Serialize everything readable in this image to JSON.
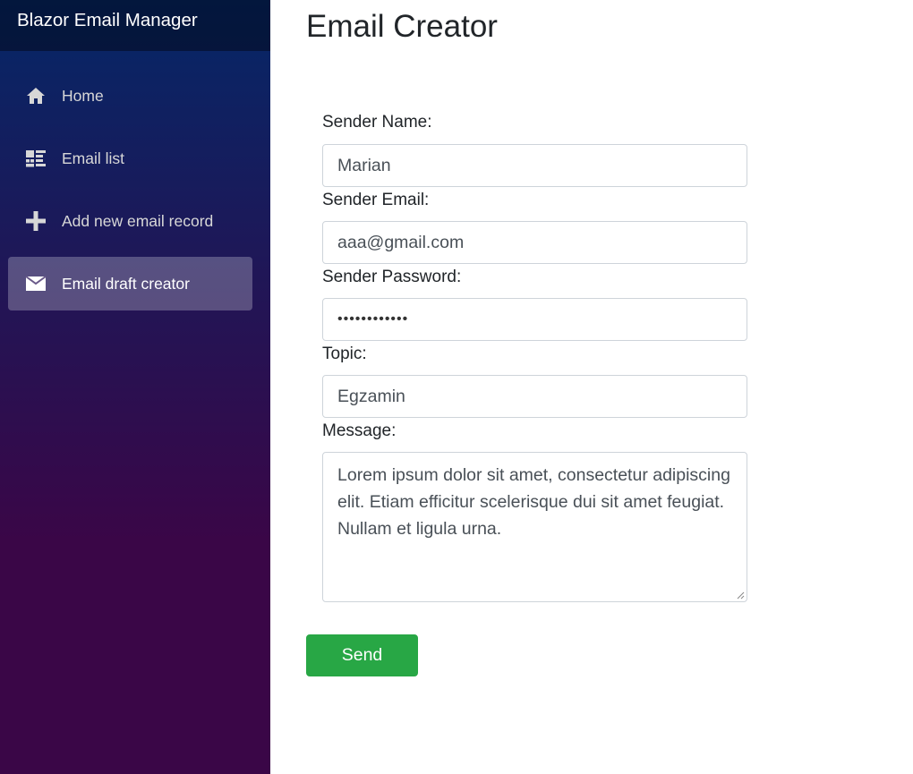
{
  "app": {
    "brand": "Blazor Email Manager"
  },
  "sidebar": {
    "items": [
      {
        "label": "Home",
        "icon": "home-icon",
        "active": false
      },
      {
        "label": "Email list",
        "icon": "list-icon",
        "active": false
      },
      {
        "label": "Add new email record",
        "icon": "plus-icon",
        "active": false
      },
      {
        "label": "Email draft creator",
        "icon": "envelope-icon",
        "active": true
      }
    ]
  },
  "page": {
    "title": "Email Creator"
  },
  "form": {
    "sender_name": {
      "label": "Sender Name:",
      "value": "Marian"
    },
    "sender_email": {
      "label": "Sender Email:",
      "value": "aaa@gmail.com"
    },
    "sender_password": {
      "label": "Sender Password:",
      "value": "••••••••••••"
    },
    "topic": {
      "label": "Topic:",
      "value": "Egzamin"
    },
    "message": {
      "label": "Message:",
      "value": "Lorem ipsum dolor sit amet, consectetur adipiscing elit. Etiam efficitur scelerisque dui sit amet feugiat. Nullam et ligula urna."
    },
    "send_label": "Send"
  },
  "colors": {
    "sidebar_top": "#052767",
    "sidebar_bottom": "#3a0647",
    "send_button": "#28a745"
  }
}
